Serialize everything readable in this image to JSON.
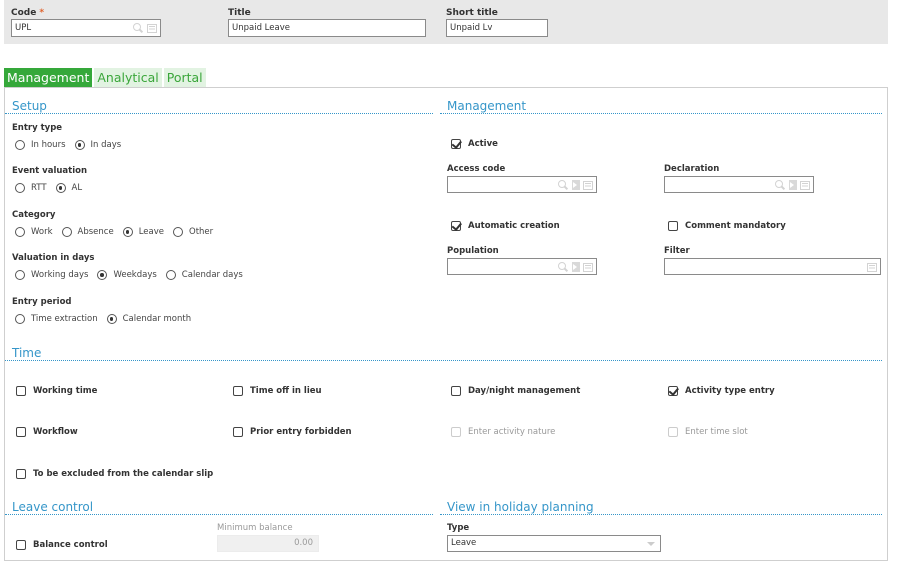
{
  "header": {
    "code": {
      "label": "Code",
      "required_marker": "*",
      "value": "UPL"
    },
    "title": {
      "label": "Title",
      "value": "Unpaid Leave"
    },
    "short_title": {
      "label": "Short title",
      "value": "Unpaid Lv"
    }
  },
  "tabs": [
    {
      "label": "Management",
      "active": true
    },
    {
      "label": "Analytical",
      "active": false
    },
    {
      "label": "Portal",
      "active": false
    }
  ],
  "setup": {
    "title": "Setup",
    "entry_type": {
      "label": "Entry type",
      "options": [
        "In hours",
        "In days"
      ],
      "selected": "In days"
    },
    "event_valuation": {
      "label": "Event valuation",
      "options": [
        "RTT",
        "AL"
      ],
      "selected": "AL"
    },
    "category": {
      "label": "Category",
      "options": [
        "Work",
        "Absence",
        "Leave",
        "Other"
      ],
      "selected": "Leave"
    },
    "valuation_in_days": {
      "label": "Valuation in days",
      "options": [
        "Working days",
        "Weekdays",
        "Calendar days"
      ],
      "selected": "Weekdays"
    },
    "entry_period": {
      "label": "Entry period",
      "options": [
        "Time extraction",
        "Calendar month"
      ],
      "selected": "Calendar month"
    }
  },
  "management": {
    "title": "Management",
    "active": {
      "label": "Active",
      "checked": true
    },
    "access_code": {
      "label": "Access code",
      "value": ""
    },
    "declaration": {
      "label": "Declaration",
      "value": ""
    },
    "automatic_creation": {
      "label": "Automatic creation",
      "checked": true
    },
    "comment_mandatory": {
      "label": "Comment mandatory",
      "checked": false
    },
    "population": {
      "label": "Population",
      "value": ""
    },
    "filter": {
      "label": "Filter",
      "value": ""
    }
  },
  "time": {
    "title": "Time",
    "checks": [
      {
        "label": "Working time",
        "checked": false,
        "disabled": false
      },
      {
        "label": "Time off in lieu",
        "checked": false,
        "disabled": false
      },
      {
        "label": "Day/night management",
        "checked": false,
        "disabled": false
      },
      {
        "label": "Activity type entry",
        "checked": true,
        "disabled": false
      },
      {
        "label": "Workflow",
        "checked": false,
        "disabled": false
      },
      {
        "label": "Prior entry forbidden",
        "checked": false,
        "disabled": false
      },
      {
        "label": "Enter activity nature",
        "checked": false,
        "disabled": true
      },
      {
        "label": "Enter time slot",
        "checked": false,
        "disabled": true
      },
      {
        "label": "To be excluded from the calendar slip",
        "checked": false,
        "disabled": false
      }
    ]
  },
  "leave_control": {
    "title": "Leave control",
    "balance_control": {
      "label": "Balance control",
      "checked": false
    },
    "minimum_balance": {
      "label": "Minimum balance",
      "value": "0.00"
    }
  },
  "holiday_planning": {
    "title": "View in holiday planning",
    "type": {
      "label": "Type",
      "value": "Leave"
    }
  },
  "icons": {
    "search": "search-icon",
    "list": "list-icon",
    "navigate": "navigate-icon",
    "dropdown": "chevron-down-icon"
  }
}
